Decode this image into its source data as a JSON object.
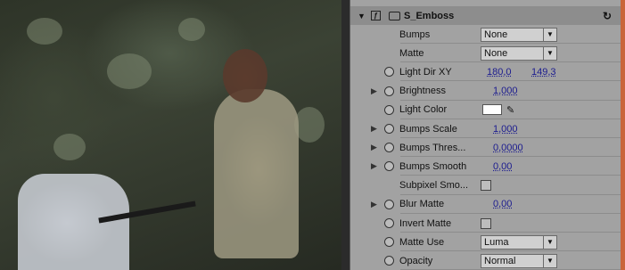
{
  "effect": {
    "name": "S_Emboss",
    "params": [
      {
        "label": "Bumps",
        "kind": "select",
        "value": "None",
        "twirl": false,
        "stopwatch": false
      },
      {
        "label": "Matte",
        "kind": "select",
        "value": "None",
        "twirl": false,
        "stopwatch": false
      },
      {
        "label": "Light Dir XY",
        "kind": "xy",
        "x": "180,0",
        "y": "149,3",
        "twirl": false,
        "stopwatch": true
      },
      {
        "label": "Brightness",
        "kind": "num",
        "value": "1,000",
        "twirl": true,
        "stopwatch": true
      },
      {
        "label": "Light Color",
        "kind": "color",
        "value": "#ffffff",
        "twirl": false,
        "stopwatch": true
      },
      {
        "label": "Bumps Scale",
        "kind": "num",
        "value": "1,000",
        "twirl": true,
        "stopwatch": true
      },
      {
        "label": "Bumps Thres...",
        "kind": "num",
        "value": "0,0000",
        "twirl": true,
        "stopwatch": true
      },
      {
        "label": "Bumps Smooth",
        "kind": "num",
        "value": "0,00",
        "twirl": true,
        "stopwatch": true
      },
      {
        "label": "Subpixel Smo...",
        "kind": "check",
        "value": false,
        "twirl": false,
        "stopwatch": false
      },
      {
        "label": "Blur Matte",
        "kind": "num",
        "value": "0,00",
        "twirl": true,
        "stopwatch": true
      },
      {
        "label": "Invert Matte",
        "kind": "check",
        "value": false,
        "twirl": false,
        "stopwatch": true
      },
      {
        "label": "Matte Use",
        "kind": "select",
        "value": "Luma",
        "twirl": false,
        "stopwatch": true
      },
      {
        "label": "Opacity",
        "kind": "select",
        "value": "Normal",
        "twirl": false,
        "stopwatch": true
      }
    ]
  },
  "icons": {
    "twirl": "triangle-right",
    "twirl_open": "triangle-down",
    "stopwatch": "stopwatch-icon",
    "reset": "reset-icon",
    "dropper": "eyedropper-icon"
  },
  "colors": {
    "panel": "#a2a2a2",
    "header": "#8d8d8d",
    "value_link": "#1b1b8f"
  }
}
